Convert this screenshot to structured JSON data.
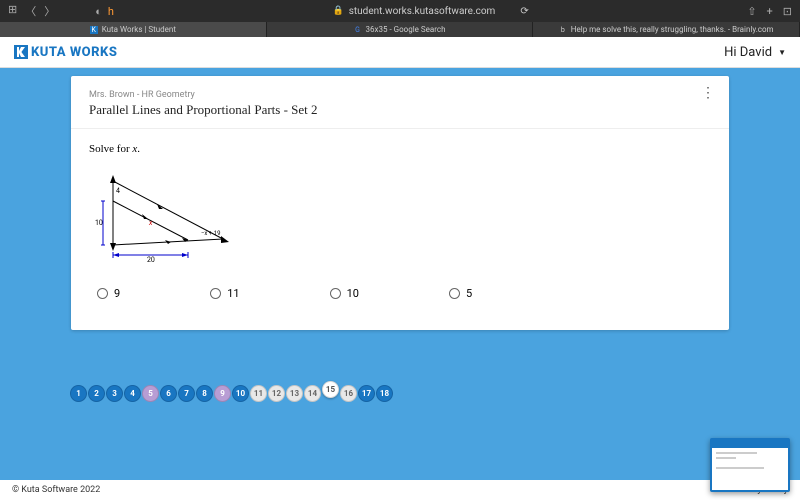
{
  "browser": {
    "url": "student.works.kutasoftware.com",
    "tabs": [
      {
        "icon": "K",
        "label": "Kuta Works | Student"
      },
      {
        "icon": "G",
        "label": "36x35 - Google Search"
      },
      {
        "icon": "b",
        "label": "Help me solve this, really struggling, thanks. - Brainly.com"
      }
    ]
  },
  "header": {
    "logo_text": "KUTA WORKS",
    "user_greeting": "Hi David"
  },
  "question": {
    "breadcrumb": "Mrs. Brown - HR Geometry",
    "title": "Parallel Lines and Proportional Parts - Set 2",
    "prompt": "Solve for x.",
    "figure": {
      "label_left": "10",
      "label_top": "4",
      "label_mid": "x",
      "label_right": "−x + 19",
      "label_bottom": "20"
    },
    "choices": [
      "9",
      "11",
      "10",
      "5"
    ]
  },
  "pager": [
    {
      "n": "1",
      "state": "done"
    },
    {
      "n": "2",
      "state": "done"
    },
    {
      "n": "3",
      "state": "done"
    },
    {
      "n": "4",
      "state": "done"
    },
    {
      "n": "5",
      "state": "purple"
    },
    {
      "n": "6",
      "state": "done"
    },
    {
      "n": "7",
      "state": "done"
    },
    {
      "n": "8",
      "state": "done"
    },
    {
      "n": "9",
      "state": "purple"
    },
    {
      "n": "10",
      "state": "done"
    },
    {
      "n": "11",
      "state": "pending"
    },
    {
      "n": "12",
      "state": "pending"
    },
    {
      "n": "13",
      "state": "pending"
    },
    {
      "n": "14",
      "state": "pending"
    },
    {
      "n": "15",
      "state": "current"
    },
    {
      "n": "16",
      "state": "pending"
    },
    {
      "n": "17",
      "state": "done"
    },
    {
      "n": "18",
      "state": "done"
    }
  ],
  "footer": {
    "copyright": "© Kuta Software 2022",
    "privacy": "Privacy Policy"
  }
}
